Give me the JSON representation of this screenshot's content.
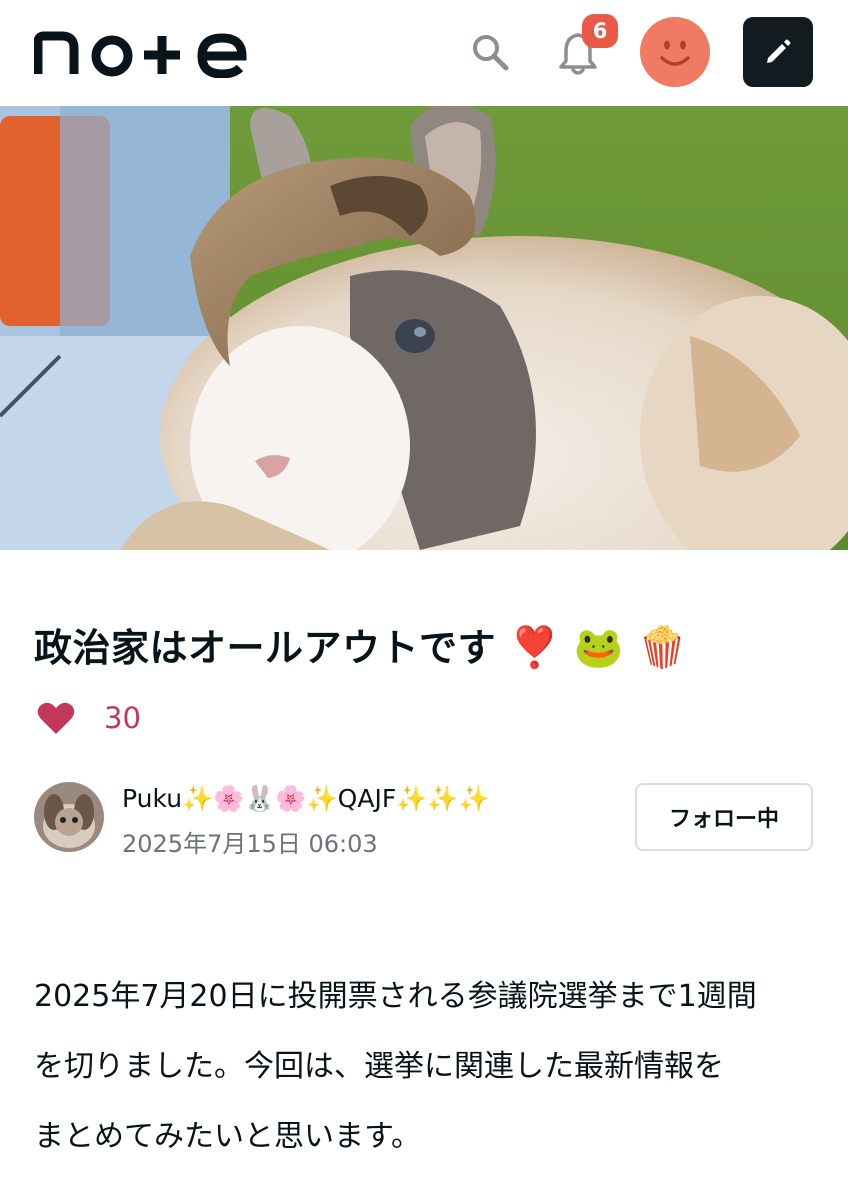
{
  "header": {
    "logo_text": "note",
    "notification_count": "6"
  },
  "article": {
    "title": "政治家はオールアウトです",
    "title_emojis": [
      "❣️",
      "🐸",
      "🍿"
    ],
    "like_count": "30",
    "author": {
      "name": "Puku✨🌸🐰🌸✨QAJF✨✨✨",
      "date": "2025年7月15日 06:03",
      "follow_label": "フォロー中"
    },
    "body": [
      "2025年7月20日に投開票される参議院選挙まで1週間",
      "を切りました。今回は、選挙に関連した最新情報を",
      "まとめてみたいと思います。"
    ]
  },
  "colors": {
    "accent_like": "#c4375c",
    "badge": "#ea5947",
    "avatar_bg": "#f07b62",
    "post_button_bg": "#111b20"
  },
  "icons": [
    "search-icon",
    "bell-icon",
    "pencil-icon",
    "heart-icon",
    "smile-icon"
  ]
}
